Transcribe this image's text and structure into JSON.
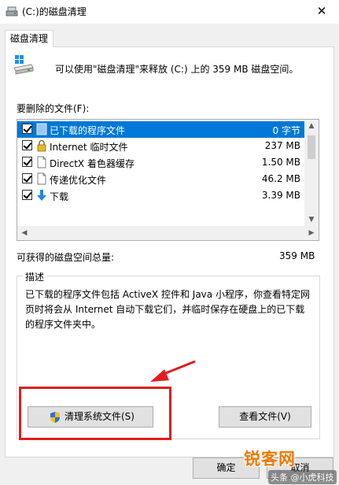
{
  "window": {
    "title": "(C:)的磁盘清理",
    "close_glyph": "✕"
  },
  "tab": {
    "label": "磁盘清理"
  },
  "summary": {
    "text": "可以使用\"磁盘清理\"来释放 (C:) 上的 359 MB 磁盘空间。"
  },
  "files": {
    "label": "要删除的文件(F):",
    "items": [
      {
        "label": "已下载的程序文件",
        "size": "0 字节",
        "checked": true,
        "selected": true,
        "icon": "folder-icon"
      },
      {
        "label": "Internet 临时文件",
        "size": "237 MB",
        "checked": true,
        "selected": false,
        "icon": "lock-icon"
      },
      {
        "label": "DirectX 着色器缓存",
        "size": "1.50 MB",
        "checked": true,
        "selected": false,
        "icon": "document-icon"
      },
      {
        "label": "传递优化文件",
        "size": "46.2 MB",
        "checked": true,
        "selected": false,
        "icon": "document-icon"
      },
      {
        "label": "下载",
        "size": "3.39 MB",
        "checked": true,
        "selected": false,
        "icon": "download-arrow-icon"
      }
    ]
  },
  "total": {
    "label": "可获得的磁盘空间总量:",
    "value": "359 MB"
  },
  "description": {
    "title": "描述",
    "text": "已下载的程序文件包括 ActiveX 控件和 Java 小程序，你查看特定网页时将会从 Internet 自动下载它们，并临时保存在硬盘上的已下载的程序文件夹中。"
  },
  "buttons": {
    "clean_system": "清理系统文件(S)",
    "view_files": "查看文件(V)",
    "ok": "确定",
    "cancel": "取消"
  },
  "watermark": {
    "big": "锐客网",
    "small": "头条 @小虎科技"
  },
  "colors": {
    "selection": "#0078d7",
    "highlight": "#e11e1e",
    "watermark": "#f07800"
  }
}
